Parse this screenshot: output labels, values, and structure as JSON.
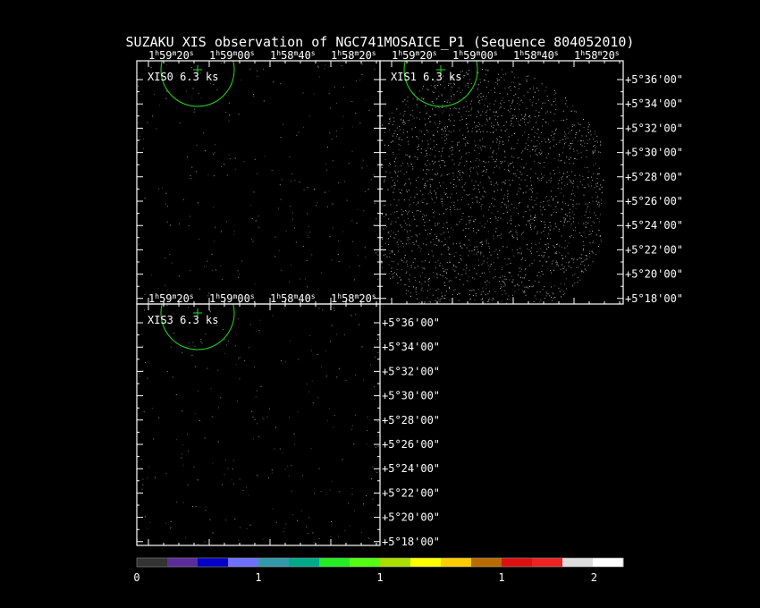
{
  "title": "SUZAKU XIS observation of NGC741MOSAICE_P1  (Sequence 804052010)",
  "ra_ticks": [
    "1h59m20s",
    "1h59m00s",
    "1h58m40s",
    "1h58m20s"
  ],
  "dec_ticks": [
    "+5°36'00\"",
    "+5°34'00\"",
    "+5°32'00\"",
    "+5°30'00\"",
    "+5°28'00\"",
    "+5°26'00\"",
    "+5°24'00\"",
    "+5°22'00\"",
    "+5°20'00\"",
    "+5°18'00\""
  ],
  "panels": [
    {
      "id": "xis0",
      "label": "XIS0 6.3 ks",
      "density": "low"
    },
    {
      "id": "xis1",
      "label": "XIS1 6.3 ks",
      "density": "high"
    },
    {
      "id": "xis3",
      "label": "XIS3 6.3 ks",
      "density": "low"
    }
  ],
  "colorbar": {
    "colors": [
      "#333333",
      "#5a2d9a",
      "#0000c8",
      "#7070ff",
      "#3399aa",
      "#00aa88",
      "#22ee22",
      "#55ff11",
      "#aadd00",
      "#ffff00",
      "#ffcc00",
      "#b86b00",
      "#dd1111",
      "#ee2222",
      "#dddddd",
      "#ffffff"
    ],
    "labels": [
      "0",
      "1",
      "1",
      "1",
      "2"
    ]
  },
  "overlay_color": "#22dd22"
}
